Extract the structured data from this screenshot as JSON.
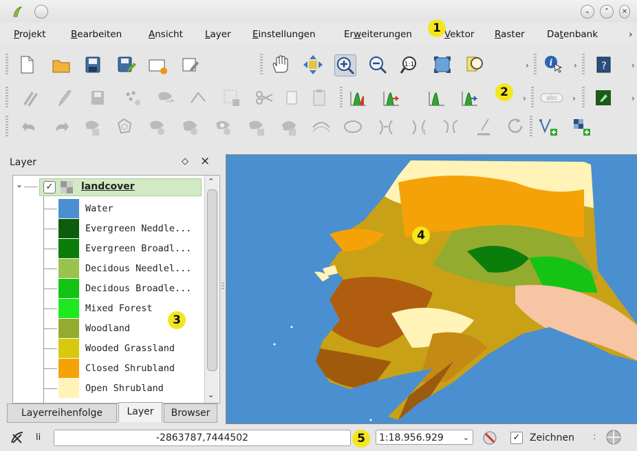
{
  "menubar": {
    "items": [
      {
        "label": "Projekt",
        "u": "P",
        "rest": "rojekt"
      },
      {
        "label": "Bearbeiten",
        "u": "B",
        "rest": "earbeiten"
      },
      {
        "label": "Ansicht",
        "u": "A",
        "rest": "nsicht"
      },
      {
        "label": "Layer",
        "u": "L",
        "rest": "ayer"
      },
      {
        "label": "Einstellungen",
        "u": "E",
        "rest": "instellungen"
      },
      {
        "label": "Erweiterungen",
        "pre": "Er",
        "u": "w",
        "rest": "eiterungen"
      },
      {
        "label": "Vektor",
        "u": "V",
        "rest": "ektor"
      },
      {
        "label": "Raster",
        "u": "R",
        "rest": "aster"
      },
      {
        "label": "Datenbank",
        "pre": "Da",
        "u": "t",
        "rest": "enbank"
      }
    ]
  },
  "callouts": [
    "1",
    "2",
    "3",
    "4",
    "5"
  ],
  "layer_panel": {
    "title": "Layer",
    "float_glyph": "◇",
    "close_glyph": "×",
    "layer_name": "landcover",
    "legend": [
      {
        "label": "Water",
        "color": "#4a8fd0"
      },
      {
        "label": "Evergreen Neddle...",
        "color": "#0b5e0b"
      },
      {
        "label": "Evergreen Broadl...",
        "color": "#0b7d0b"
      },
      {
        "label": "Decidous Needlel...",
        "color": "#9ac24e"
      },
      {
        "label": "Decidous Broadle...",
        "color": "#15c315"
      },
      {
        "label": "Mixed Forest",
        "color": "#1ee81e"
      },
      {
        "label": "Woodland",
        "color": "#93ab2e"
      },
      {
        "label": "Wooded Grassland",
        "color": "#d8c90e"
      },
      {
        "label": "Closed Shrubland",
        "color": "#f5a208"
      },
      {
        "label": "Open Shrubland",
        "color": "#fff3b8"
      }
    ],
    "tabs": [
      "Layerreihenfolge",
      "Layer",
      "Browser"
    ]
  },
  "statusbar": {
    "coord_label": "li",
    "coordinates": "-2863787,7444502",
    "scale": "1:18.956.929",
    "render_label": "Zeichnen"
  }
}
